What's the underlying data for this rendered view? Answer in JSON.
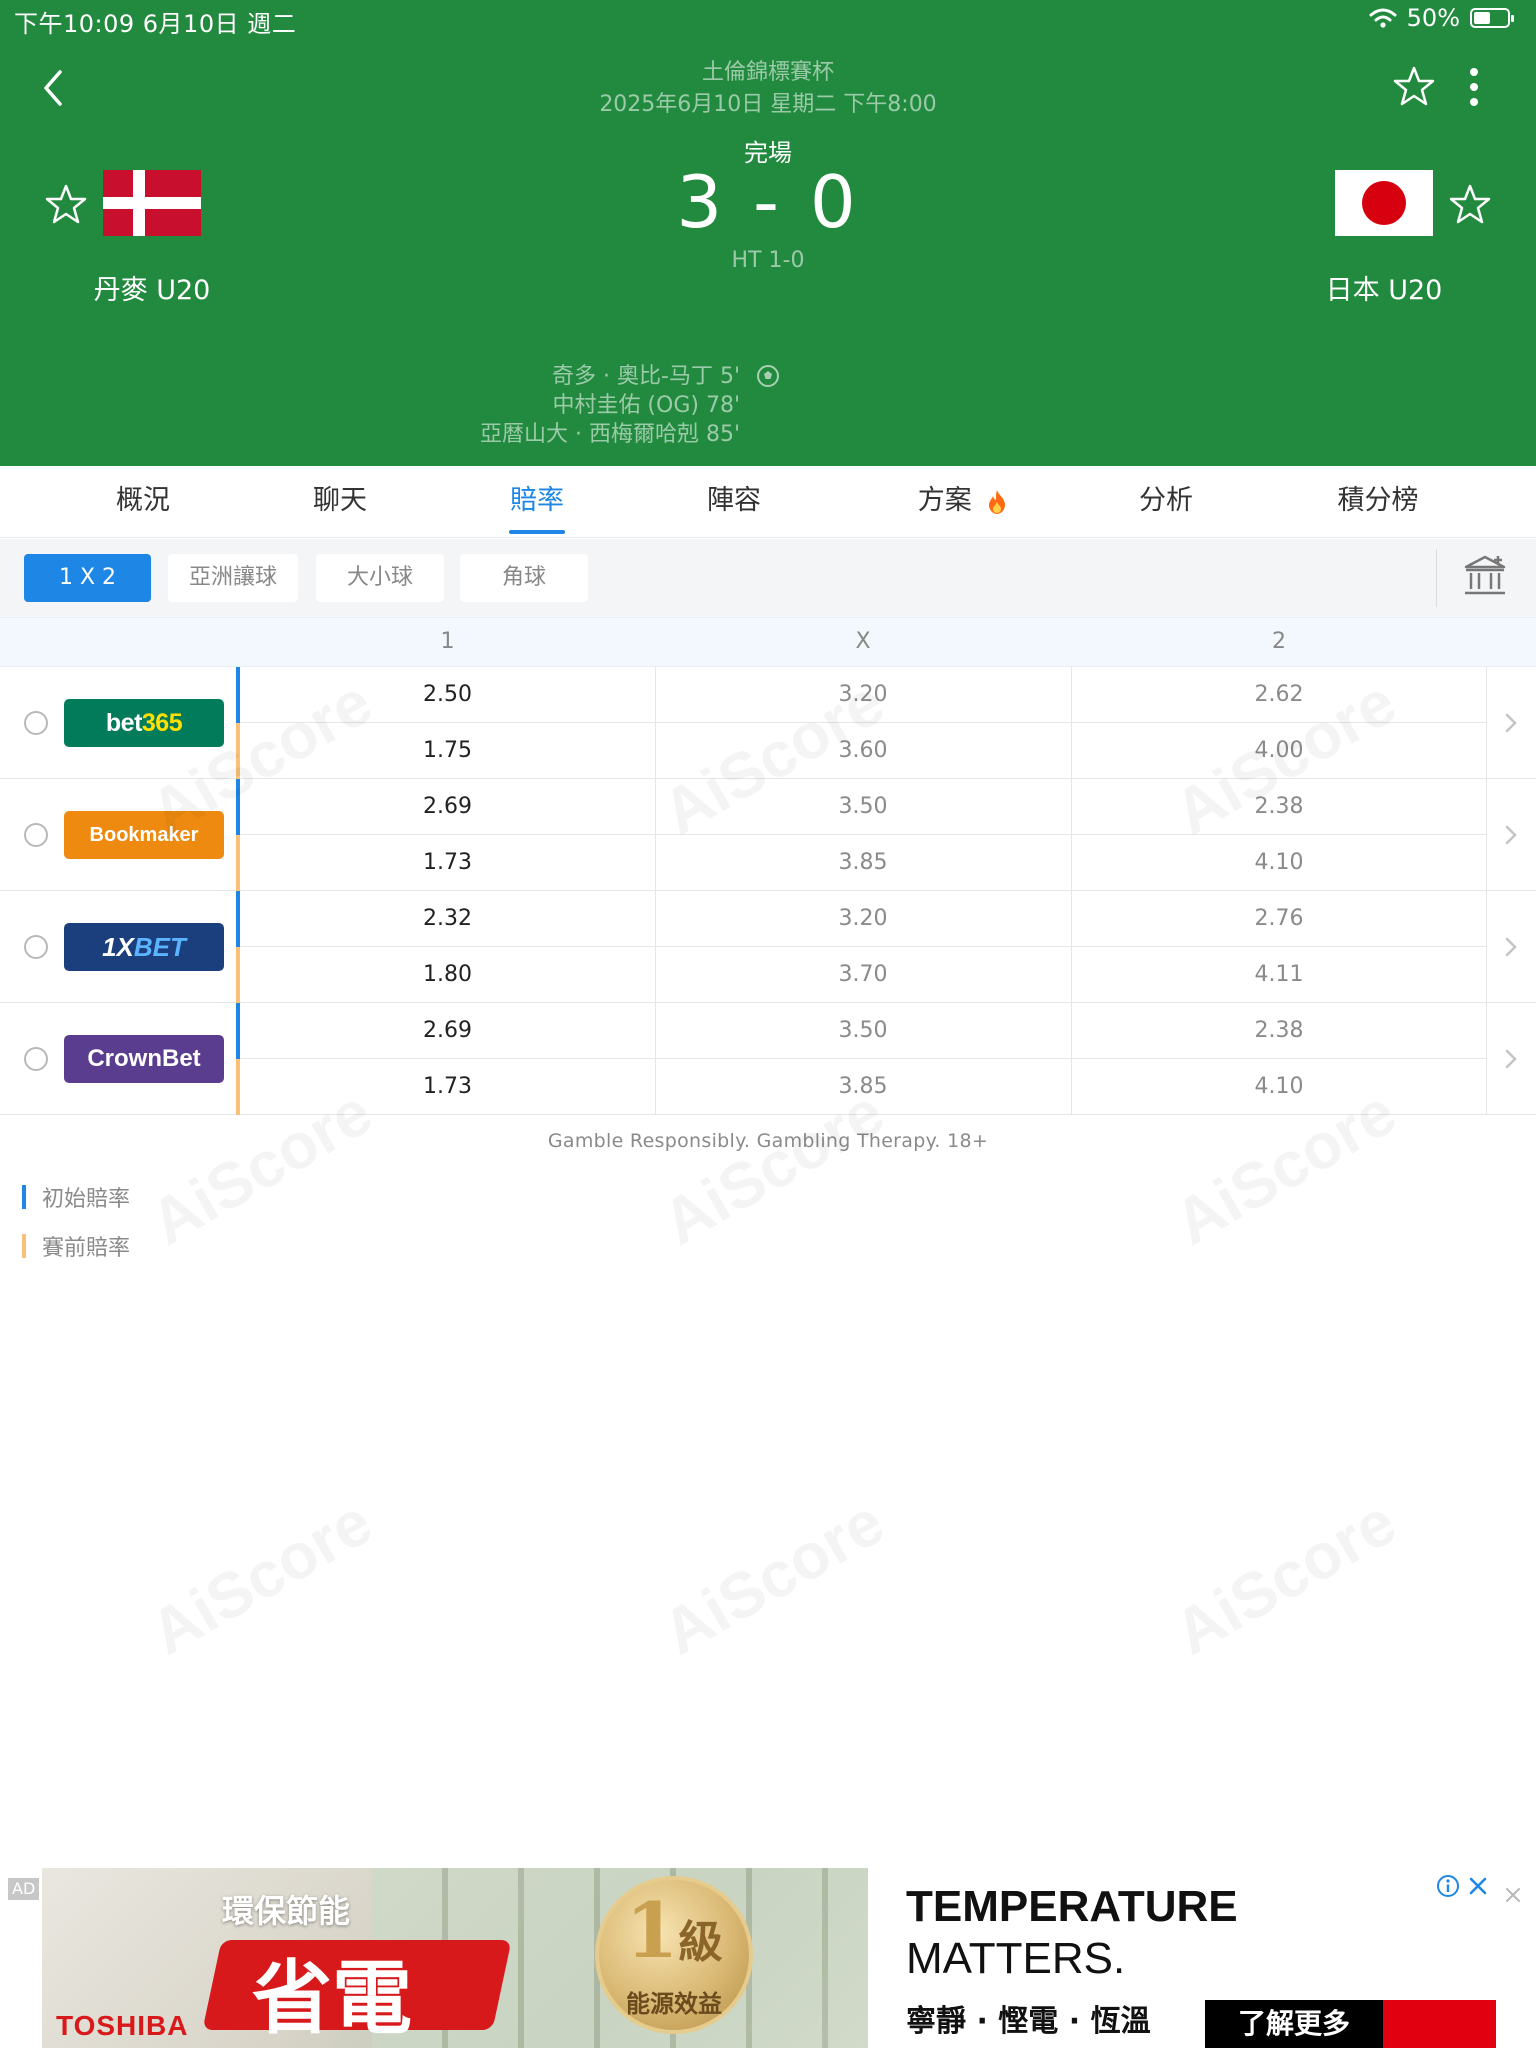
{
  "status_bar": {
    "time": "下午10:09   6月10日 週二",
    "battery": "50%"
  },
  "match": {
    "league": "土倫錦標賽杯",
    "datetime": "2025年6月10日 星期二 下午8:00",
    "status": "完場",
    "score": "3 - 0",
    "halftime": "HT 1-0",
    "home": {
      "name": "丹麥 U20",
      "flag": "denmark-flag"
    },
    "away": {
      "name": "日本 U20",
      "flag": "japan-flag"
    },
    "scorers": [
      "奇多 · 奧比-马丁 5'",
      "中村圭佑 (OG) 78'",
      "亞暦山大 · 西梅爾哈剋 85'"
    ]
  },
  "tabs": [
    "概況",
    "聊天",
    "賠率",
    "陣容",
    "方案",
    "分析",
    "積分榜"
  ],
  "active_tab": "賠率",
  "subtabs": [
    "1 X 2",
    "亞洲讓球",
    "大小球",
    "角球"
  ],
  "active_subtab": "1 X 2",
  "columns": [
    "1",
    "X",
    "2"
  ],
  "bookmakers": [
    {
      "name": "bet365",
      "name_a": "bet",
      "name_b": "365",
      "color": "#027b5b",
      "open": [
        "2.50",
        "3.20",
        "2.62"
      ],
      "pre": [
        "1.75",
        "3.60",
        "4.00"
      ]
    },
    {
      "name": "Bookmaker",
      "color": "#ee8a10",
      "open": [
        "2.69",
        "3.50",
        "2.38"
      ],
      "pre": [
        "1.73",
        "3.85",
        "4.10"
      ]
    },
    {
      "name_a": "1X",
      "name_b": "BET",
      "color": "#1b3f7c",
      "open": [
        "2.32",
        "3.20",
        "2.76"
      ],
      "pre": [
        "1.80",
        "3.70",
        "4.11"
      ]
    },
    {
      "name": "CrownBet",
      "color": "#5a3d8f",
      "open": [
        "2.69",
        "3.50",
        "2.38"
      ],
      "pre": [
        "1.73",
        "3.85",
        "4.10"
      ]
    }
  ],
  "disclaimer": "Gamble Responsibly. Gambling Therapy. 18+",
  "legend": [
    {
      "label": "初始賠率",
      "color": "#1e87e5"
    },
    {
      "label": "賽前賠率",
      "color": "#f8c078"
    }
  ],
  "watermark": "AiScore",
  "ad": {
    "badge": "AD",
    "slogan_top": "環保節能",
    "slogan_big": "省電",
    "brand": "TOSHIBA",
    "medal_number": "1",
    "medal_grade": "級",
    "medal_text": "能源效益",
    "headline": "TEMPERATURE",
    "subheadline": "MATTERS.",
    "tagline": "寧靜 · 慳電 · 恆溫",
    "cta": "了解更多"
  },
  "colors": {
    "header_green": "#228a3f",
    "accent_blue": "#1e87e5",
    "prematch_orange": "#f8c078"
  }
}
